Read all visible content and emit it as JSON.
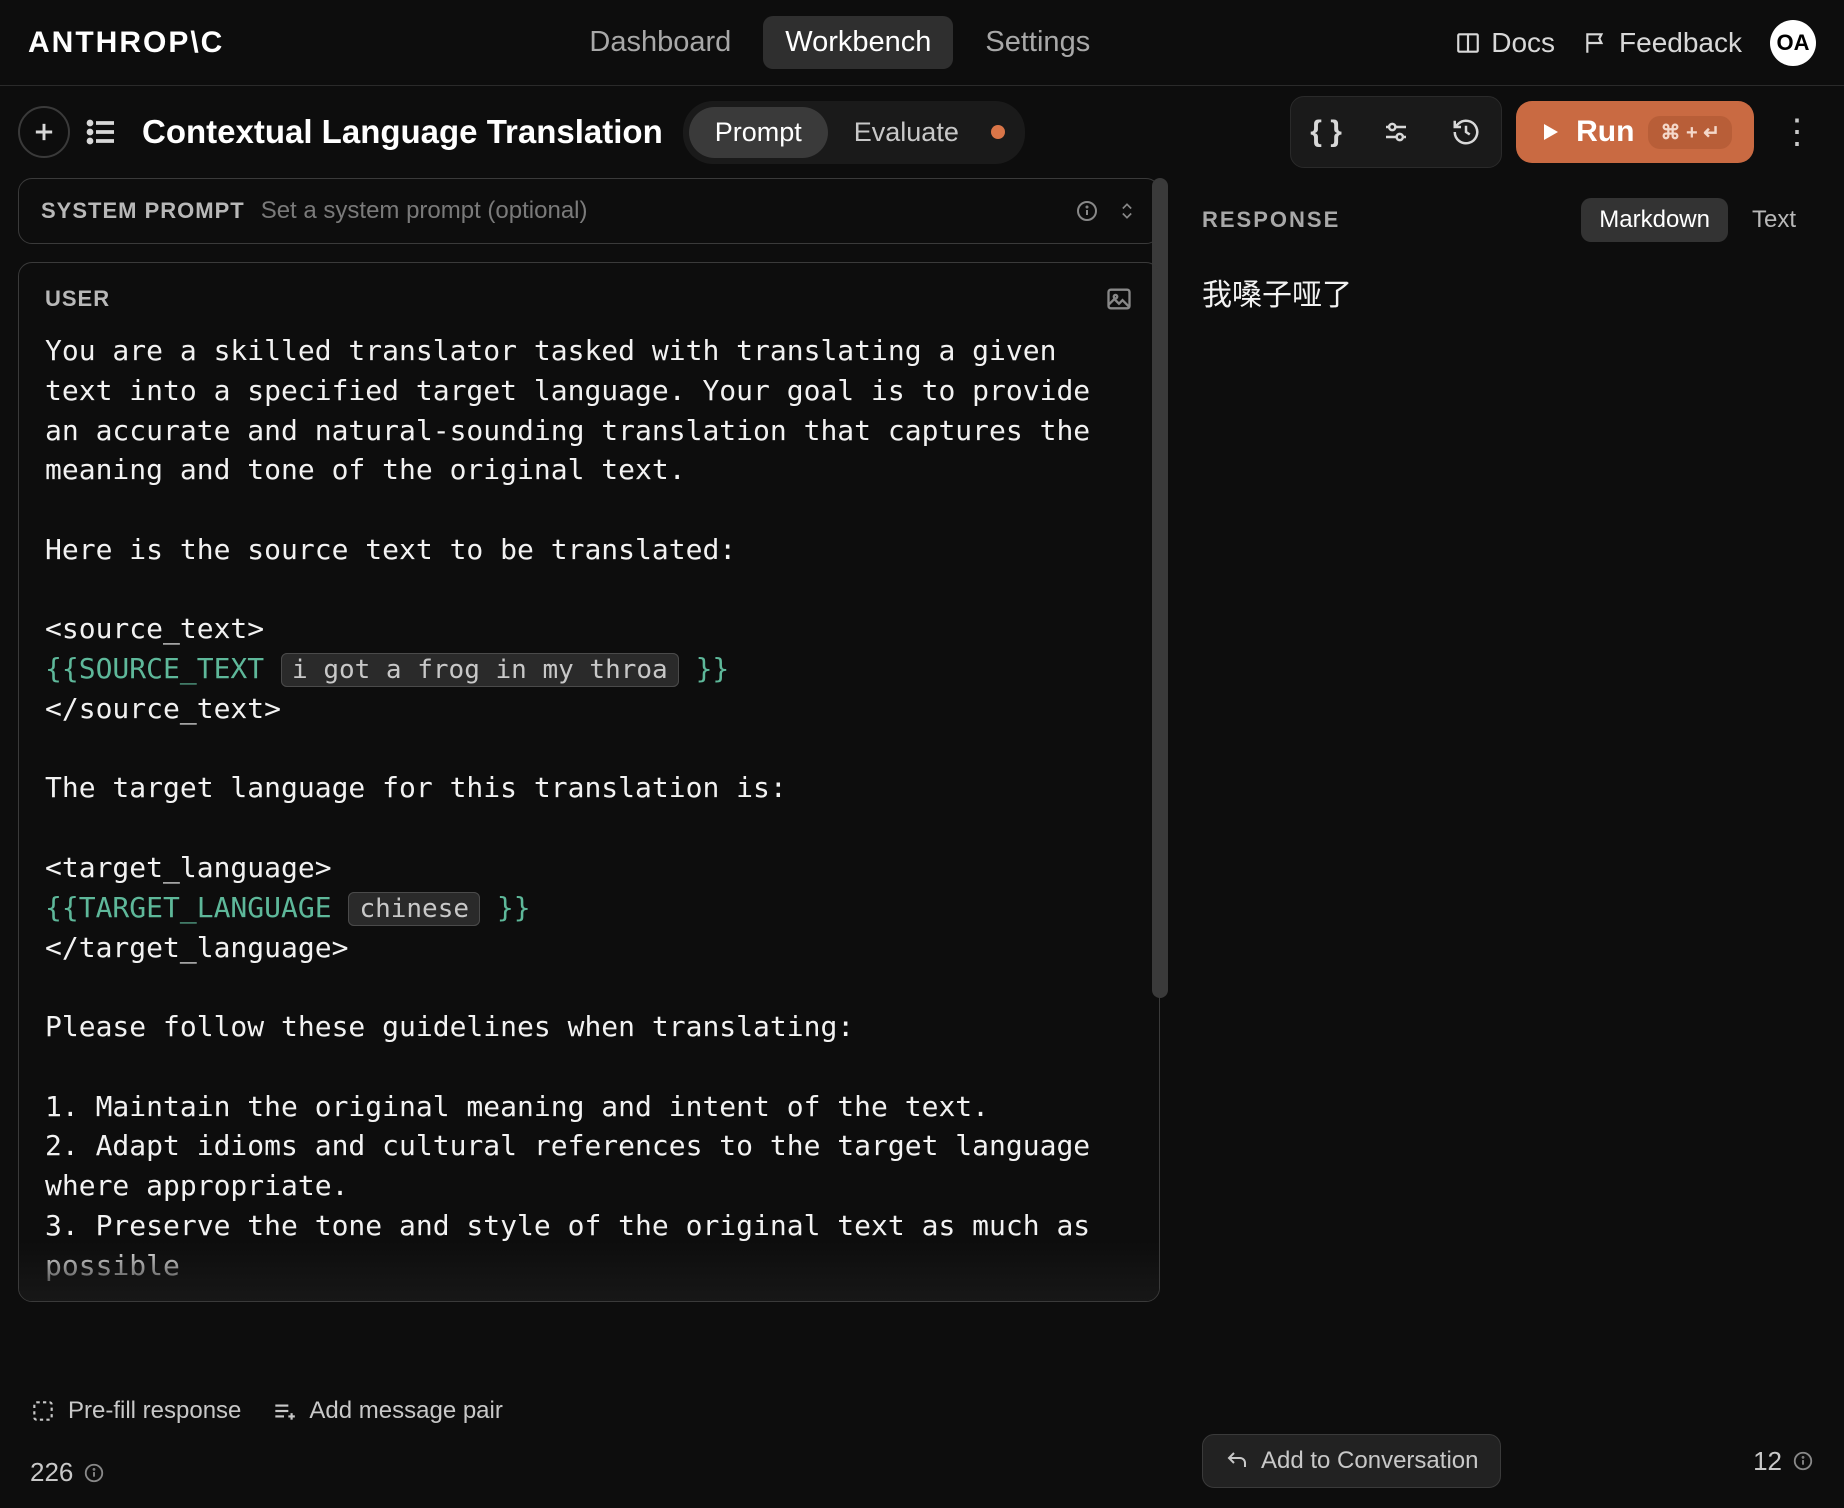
{
  "topnav": {
    "logo": "ANTHROP\\C",
    "items": [
      "Dashboard",
      "Workbench",
      "Settings"
    ],
    "active_index": 1,
    "docs_label": "Docs",
    "feedback_label": "Feedback",
    "avatar_initials": "OA"
  },
  "toolbar": {
    "title": "Contextual Language Translation",
    "tabs": {
      "prompt": "Prompt",
      "evaluate": "Evaluate",
      "active": "prompt",
      "has_indicator": true
    },
    "run_label": "Run",
    "run_kbd": "⌘ + ↵"
  },
  "system_prompt": {
    "label": "SYSTEM PROMPT",
    "placeholder": "Set a system prompt (optional)"
  },
  "user_message": {
    "label": "USER",
    "body_part1": "You are a skilled translator tasked with translating a given text into a specified target language. Your goal is to provide an accurate and natural-sounding translation that captures the meaning and tone of the original text.\n\nHere is the source text to be translated:\n\n",
    "tag_open_source": "<source_text>",
    "var_source_name": "{{SOURCE_TEXT",
    "var_source_value": "i got a frog in my throa",
    "var_close": "}}",
    "tag_close_source": "</source_text>",
    "body_part2": "\n\nThe target language for this translation is:\n\n",
    "tag_open_target": "<target_language>",
    "var_target_name": "{{TARGET_LANGUAGE",
    "var_target_value": "chinese",
    "tag_close_target": "</target_language>",
    "body_part3": "\n\nPlease follow these guidelines when translating:\n\n1. Maintain the original meaning and intent of the text.\n2. Adapt idioms and cultural references to the target language where appropriate.\n3. Preserve the tone and style of the original text as much as possible"
  },
  "left_footer": {
    "prefill": "Pre-fill response",
    "add_pair": "Add message pair",
    "token_count": "226"
  },
  "response": {
    "label": "RESPONSE",
    "views": {
      "markdown": "Markdown",
      "text": "Text",
      "active": "markdown"
    },
    "body": "我嗓子哑了",
    "add_conv": "Add to Conversation",
    "token_count": "12"
  },
  "colors": {
    "accent": "#c96a42",
    "var_green": "#5eb89a"
  }
}
